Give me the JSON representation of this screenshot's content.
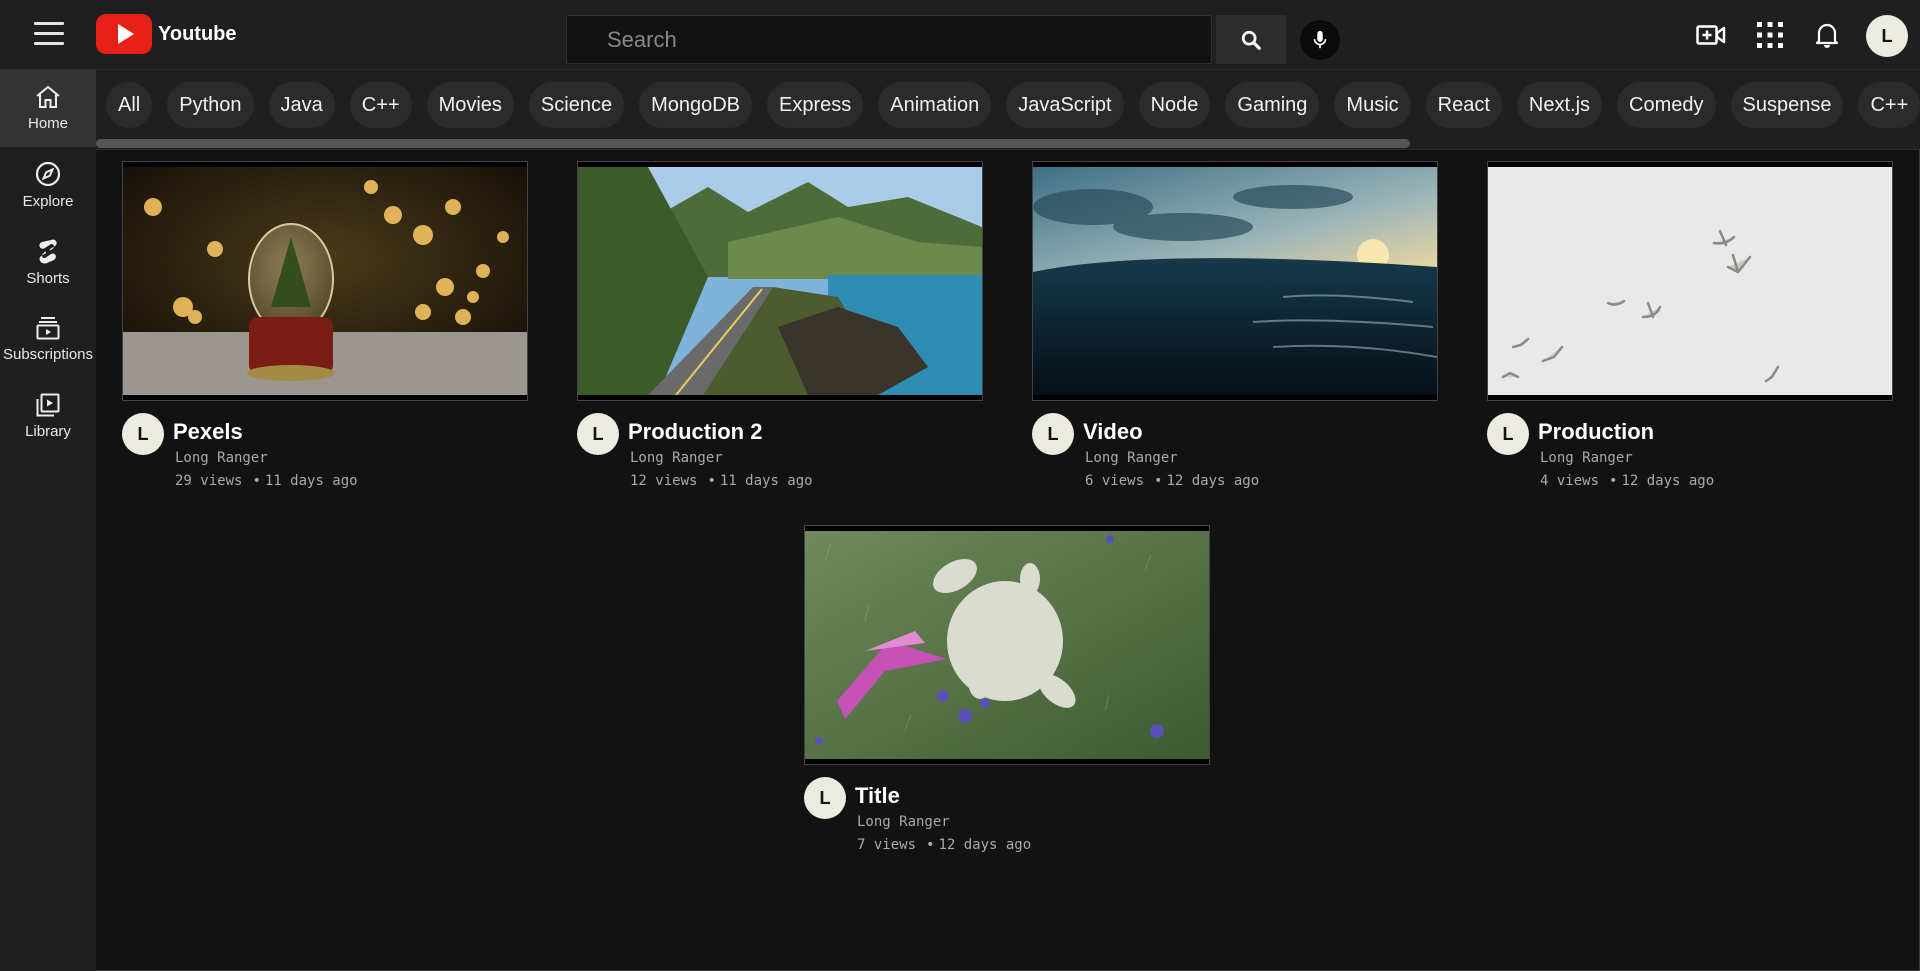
{
  "app": {
    "name": "Youtube"
  },
  "search": {
    "placeholder": "Search",
    "value": ""
  },
  "header": {
    "avatar_letter": "L"
  },
  "sidebar": {
    "items": [
      {
        "label": "Home",
        "icon": "home-icon",
        "active": true
      },
      {
        "label": "Explore",
        "icon": "compass-icon"
      },
      {
        "label": "Shorts",
        "icon": "shorts-icon"
      },
      {
        "label": "Subscriptions",
        "icon": "subscriptions-icon"
      },
      {
        "label": "Library",
        "icon": "library-icon"
      }
    ]
  },
  "chips": [
    "All",
    "Python",
    "Java",
    "C++",
    "Movies",
    "Science",
    "MongoDB",
    "Express",
    "Animation",
    "JavaScript",
    "Node",
    "Gaming",
    "Music",
    "React",
    "Next.js",
    "Comedy",
    "Suspense",
    "C++"
  ],
  "videos": [
    {
      "title": "Pexels",
      "channel": "Long Ranger",
      "views": "29 views",
      "age": "11 days ago",
      "avatar": "L",
      "thumbnail": "snow-globe-bokeh"
    },
    {
      "title": "Production 2",
      "channel": "Long Ranger",
      "views": "12 views",
      "age": "11 days ago",
      "avatar": "L",
      "thumbnail": "coastal-road-mountains"
    },
    {
      "title": "Video",
      "channel": "Long Ranger",
      "views": "6 views",
      "age": "12 days ago",
      "avatar": "L",
      "thumbnail": "ocean-sunset"
    },
    {
      "title": "Production",
      "channel": "Long Ranger",
      "views": "4 views",
      "age": "12 days ago",
      "avatar": "L",
      "thumbnail": "seagulls-sky"
    },
    {
      "title": "Title",
      "channel": "Long Ranger",
      "views": "7 views",
      "age": "12 days ago",
      "avatar": "L",
      "thumbnail": "bunny-grass-butterfly"
    }
  ],
  "colors": {
    "brand_red": "#e62117",
    "background": "#121212",
    "surface": "#1f1f1f"
  }
}
